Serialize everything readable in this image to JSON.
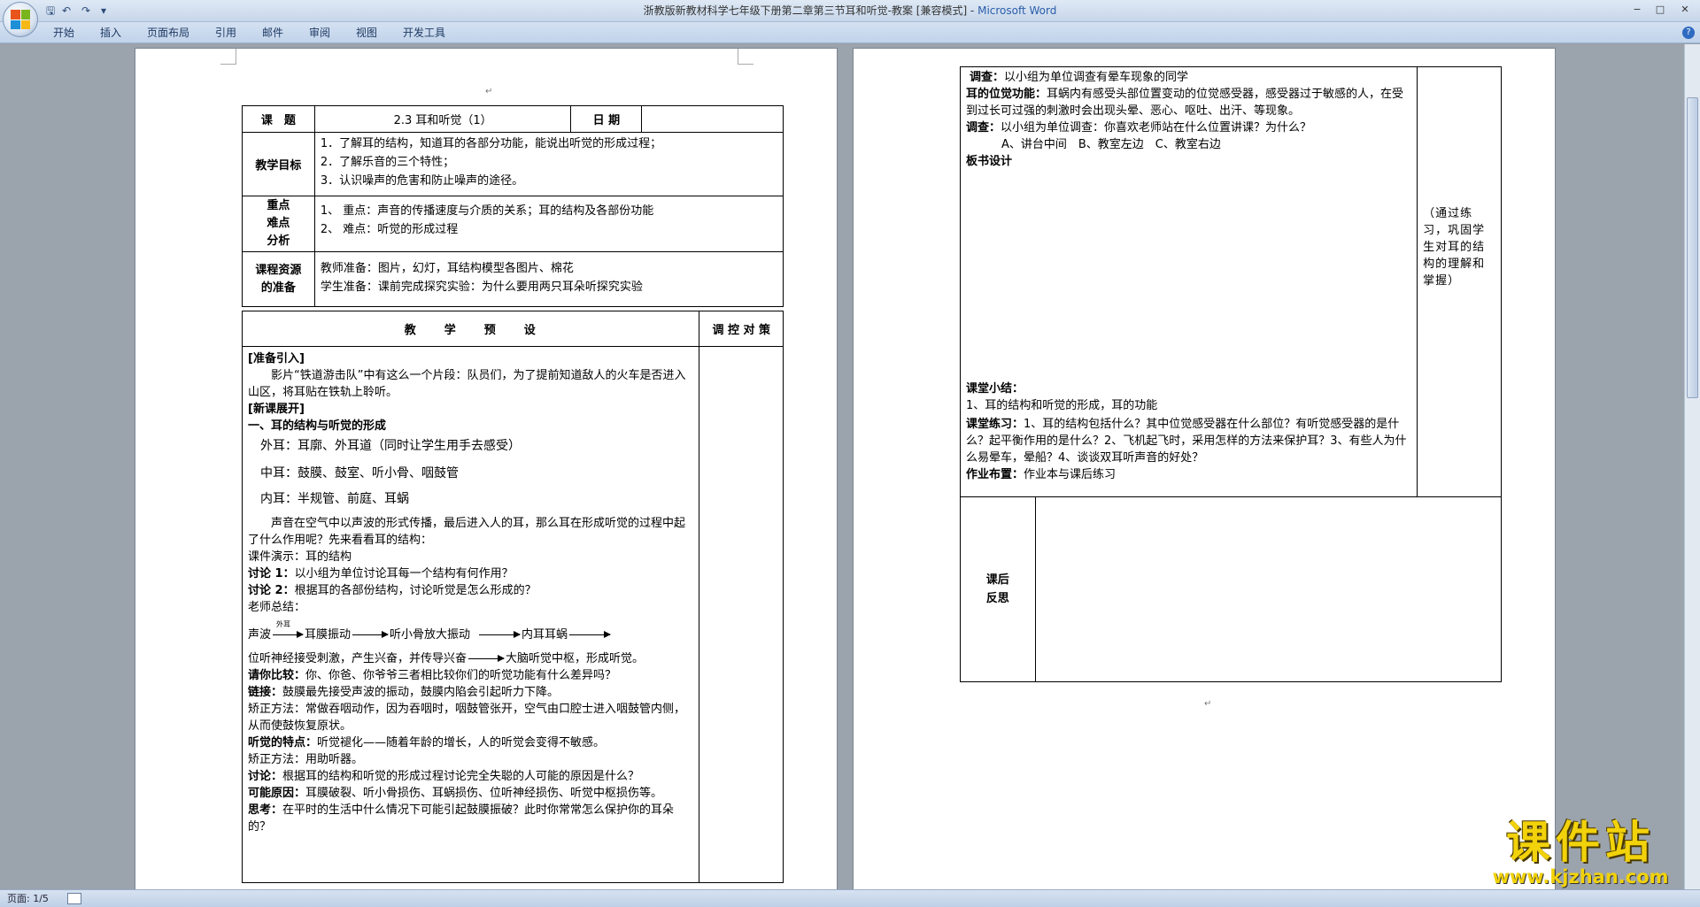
{
  "app": {
    "title_doc": "浙教版新教材科学七年级下册第二章第三节耳和听觉-教案 [兼容模式] - ",
    "title_app": "Microsoft Word",
    "qa_save": "🖫",
    "qa_undo": "↶",
    "qa_redo": "↷",
    "qa_more": "▾",
    "btn_min": "−",
    "btn_max": "□",
    "btn_close": "✕",
    "help": "?"
  },
  "ribbon": {
    "tabs": [
      "开始",
      "插入",
      "页面布局",
      "引用",
      "邮件",
      "审阅",
      "视图",
      "开发工具"
    ]
  },
  "status": {
    "page": "页面: 1/5"
  },
  "watermark": {
    "text": "课件站",
    "url": "www.kjzhan.com"
  },
  "page1": {
    "header": {
      "topic_label": "课　题",
      "topic_value": "2.3 耳和听觉（1）",
      "date_label": "日 期"
    },
    "goals": {
      "label": "教学目标",
      "items": [
        "1．了解耳的结构，知道耳的各部分功能，能说出听觉的形成过程；",
        "2．了解乐音的三个特性；",
        "3．认识噪声的危害和防止噪声的途径。"
      ]
    },
    "keypoints": {
      "label": "重点难点分析",
      "items": [
        "1、 重点：声音的传播速度与介质的关系；耳的结构及各部份功能",
        "2、 难点：听觉的形成过程"
      ]
    },
    "resources": {
      "label": "课程资源的准备",
      "items": [
        "教师准备：图片，幻灯，耳结构模型各图片、棉花",
        "学生准备：课前完成探究实验：为什么要用两只耳朵听探究实验"
      ]
    },
    "design_header": "教　　学　　预　　设",
    "strategy_header": "调 控 对 策",
    "intro_label": "[准备引入]",
    "intro_text": "影片“铁道游击队”中有这么一个片段：队员们，为了提前知道敌人的火车是否进入山区，将耳贴在铁轨上聆听。",
    "new_label": "[新课展开]",
    "section1": "一、耳的结构与听觉的形成",
    "outer_ear": "外耳：耳廓、外耳道（同时让学生用手去感受）",
    "middle_ear": "中耳：鼓膜、鼓室、听小骨、咽鼓管",
    "inner_ear": "内耳：半规管、前庭、耳蜗",
    "sound_para": "声音在空气中以声波的形式传播，最后进入人的耳，那么耳在形成听觉的过程中起了什么作用呢？先来看看耳的结构：",
    "courseware": "课件演示：耳的结构",
    "disc1_label": "讨论 1：",
    "disc1_text": "以小组为单位讨论耳每一个结构有何作用？",
    "disc2_label": "讨论 2：",
    "disc2_text": "根据耳的各部份结构，讨论听觉是怎么形成的？",
    "teacher_sum": "老师总结：",
    "flow": {
      "s1": "声波",
      "over": "外耳",
      "s2": "耳膜振动",
      "s3": "听小骨放大振动",
      "s4": "内耳耳蜗"
    },
    "flow2_a": "位听神经接受刺激，产生兴奋，并传导兴奋",
    "flow2_b": "大脑听觉中枢，形成听觉。",
    "compare_label": "请你比较：",
    "compare_text": "你、你爸、你爷爷三者相比较你们的听觉功能有什么差异吗？",
    "link_label": "链接：",
    "link_text": "鼓膜最先接受声波的振动，鼓膜内陷会引起听力下降。",
    "fix1": "矫正方法：常做吞咽动作，因为吞咽时，咽鼓管张开，空气由口腔士进入咽鼓管内侧，从而使鼓恢复原状。",
    "hear_label": "听觉的特点：",
    "hear_text": "听觉褪化——随着年龄的增长，人的听觉会变得不敏感。",
    "fix2": "矫正方法：用助听器。",
    "disc3_label": "讨论：",
    "disc3_text": "根据耳的结构和听觉的形成过程讨论完全失聪的人可能的原因是什么？",
    "cause_label": "可能原因：",
    "cause_text": "耳膜破裂、听小骨损伤、耳蜗损伤、位听神经损伤、听觉中枢损伤等。",
    "think_label": "思考：",
    "think_text": "在平时的生活中什么情况下可能引起鼓膜振破？此时你常常怎么保护你的耳朵的？"
  },
  "page2": {
    "survey1_label": "调查：",
    "survey1_text": "以小组为单位调查有晕车现象的同学",
    "func_label": "耳的位觉功能：",
    "func_text": "耳蜗内有感受头部位置变动的位觉感受器，感受器过于敏感的人，在受到过长可过强的刺激时会出现头晕、恶心、呕吐、出汗、等现象。",
    "survey2_label": "调查：",
    "survey2_text": "以小组为单位调查：你喜欢老师站在什么位置讲课？为什么？",
    "options": "A、讲台中间　B、教室左边　C、教室右边",
    "board_label": "板书设计",
    "summary_label": "课堂小结：",
    "summary_text": "1、耳的结构和听觉的形成，耳的功能",
    "exercise_label": "课堂练习：",
    "exercise_text": "1、耳的结构包括什么？其中位觉感受器在什么部位？有听觉感受器的是什么？起平衡作用的是什么？2、飞机起飞时，采用怎样的方法来保护耳？3、有些人为什么易晕车，晕船？4、谈谈双耳听声音的好处？",
    "homework_label": "作业布置：",
    "homework_text": "作业本与课后练习",
    "side_note": "（通过练习，巩固学生对耳的结构的理解和掌握）",
    "reflect_label": "课后反思"
  },
  "marks": {
    "para": "↵"
  }
}
